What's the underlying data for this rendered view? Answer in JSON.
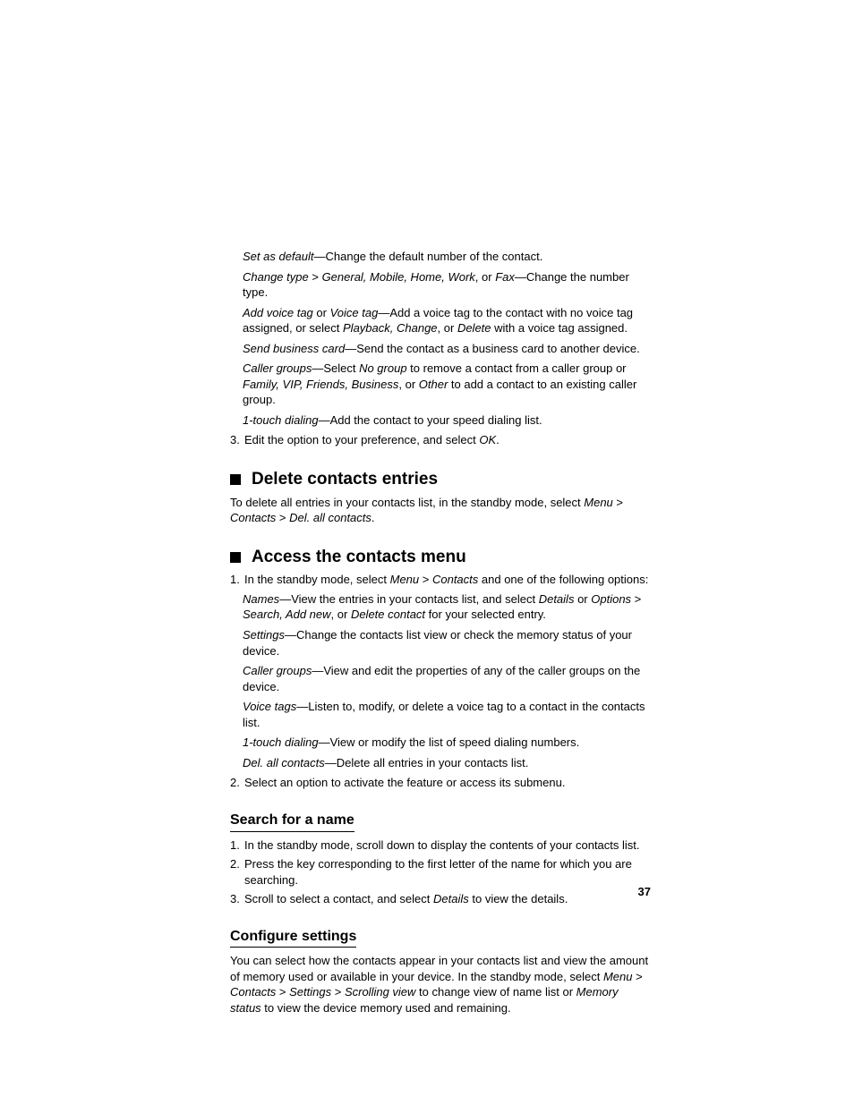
{
  "page_number": "37",
  "intro_options": [
    {
      "term": "Set as default",
      "rest": "—Change the default number of the contact."
    },
    {
      "term_prefix": "Change type",
      "gt": " > ",
      "italics_list": "General, Mobile, Home, Work",
      "or_word": ", or ",
      "italics_tail": "Fax",
      "rest": "—Change the number type."
    },
    {
      "term": "Add voice tag",
      "mid": " or ",
      "term2": "Voice tag",
      "rest1": "—Add a voice tag to the contact with no voice tag assigned, or select ",
      "italics_trio": "Playback, Change",
      "or_word": ", or ",
      "italics_last": "Delete",
      "rest2": " with a voice tag assigned."
    },
    {
      "term": "Send business card",
      "rest": "—Send the contact as a business card to another device."
    },
    {
      "term": "Caller groups",
      "rest1": "—Select ",
      "it1": "No group",
      "rest2": " to remove a contact from a caller group or ",
      "it2": "Family, VIP, Friends, Business",
      "or_word": ", or ",
      "it3": "Other",
      "rest3": " to add a contact to an existing caller group."
    },
    {
      "term": "1-touch dialing",
      "rest": "—Add the contact to your speed dialing list."
    }
  ],
  "intro_step3": {
    "num": "3.",
    "text_a": "Edit the option to your preference, and select ",
    "it": "OK",
    "text_b": "."
  },
  "sec_delete": {
    "title": "Delete contacts entries",
    "body_a": "To delete all entries in your contacts list, in the standby mode, select ",
    "it1": "Menu",
    "gt1": " > ",
    "it2": "Contacts",
    "gt2": " > ",
    "it3": "Del. all contacts",
    "body_b": "."
  },
  "sec_access": {
    "title": "Access the contacts menu",
    "step1": {
      "num": "1.",
      "a": "In the standby mode, select ",
      "it1": "Menu",
      "gt": " > ",
      "it2": "Contacts",
      "b": " and one of the following options:"
    },
    "opts": [
      {
        "term": "Names",
        "rest_a": "—View the entries in your contacts list, and select ",
        "it1": "Details",
        "mid": " or ",
        "it2": "Options",
        "gt": " > ",
        "it3": "Search, Add new",
        "or": ", or ",
        "it4": "Delete contact",
        "rest_b": " for your selected entry."
      },
      {
        "term": "Settings",
        "rest": "—Change the contacts list view or check the memory status of your device."
      },
      {
        "term": "Caller groups",
        "rest": "—View and edit the properties of any of the caller groups on the device."
      },
      {
        "term": "Voice tags",
        "rest": "—Listen to, modify, or delete a voice tag to a contact in the contacts list."
      },
      {
        "term": "1-touch dialing",
        "rest": "—View or modify the list of speed dialing numbers."
      },
      {
        "term": "Del. all contacts",
        "rest": "—Delete all entries in your contacts list."
      }
    ],
    "step2": {
      "num": "2.",
      "text": "Select an option to activate the feature or access its submenu."
    }
  },
  "sub_search": {
    "title": "Search for a name",
    "steps": [
      {
        "num": "1.",
        "text": "In the standby mode, scroll down to display the contents of your contacts list."
      },
      {
        "num": "2.",
        "text": "Press the key corresponding to the first letter of the name for which you are searching."
      },
      {
        "num": "3.",
        "a": "Scroll to select a contact, and select ",
        "it": "Details",
        "b": " to view the details."
      }
    ]
  },
  "sub_config": {
    "title": "Configure settings",
    "a": "You can select how the contacts appear in your contacts list and view the amount of memory used or available in your device. In the standby mode, select ",
    "it1": "Menu",
    "gt1": " > ",
    "it2": "Contacts",
    "gt2": " > ",
    "it3": "Settings",
    "gt3": " > ",
    "it4": "Scrolling view",
    "mid": " to change view of name list or ",
    "it5": "Memory status",
    "b": " to view the device memory used and remaining."
  }
}
